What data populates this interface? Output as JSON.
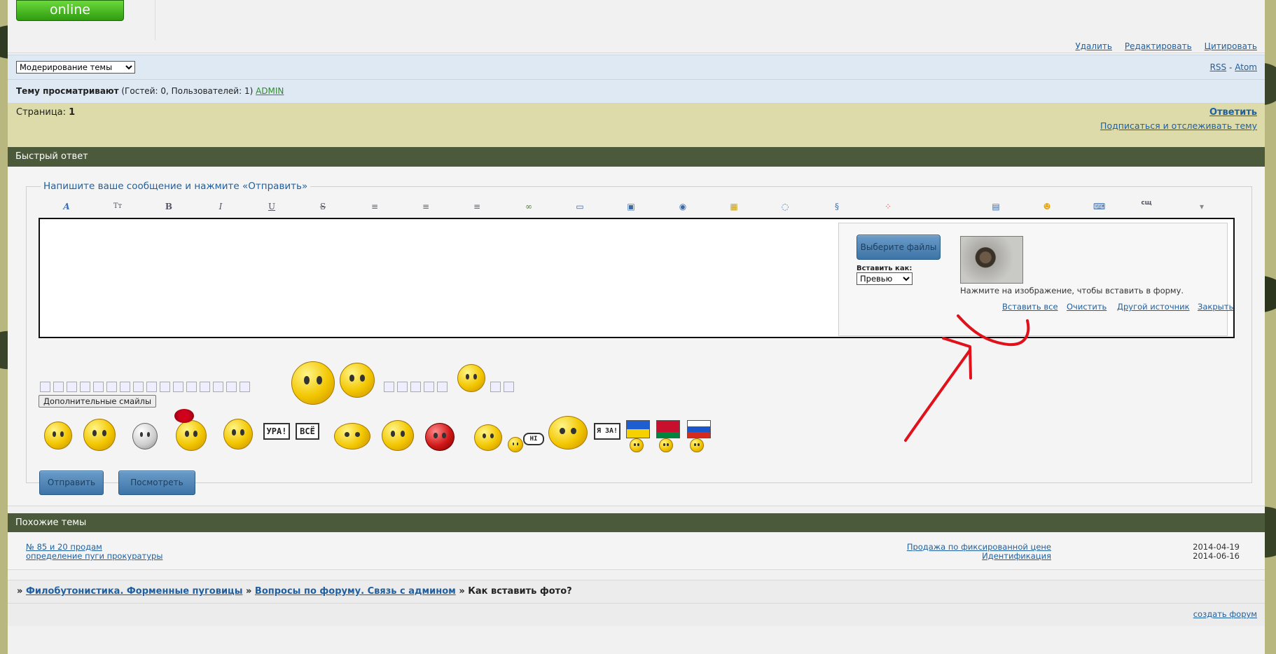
{
  "online_badge": "online",
  "post_actions": {
    "delete": "Удалить",
    "edit": "Редактировать",
    "quote": "Цитировать"
  },
  "moderation": {
    "select_value": "Модерирование темы",
    "rss": "RSS",
    "separator": "-",
    "atom": "Atom"
  },
  "viewers": {
    "label": "Тему просматривают",
    "counts": "(Гостей: 0, Пользователей: 1)",
    "user": "ADMIN"
  },
  "pagination": {
    "label": "Страница:",
    "current": "1",
    "reply": "Ответить",
    "subscribe": "Подписаться и отслеживать тему"
  },
  "quick_reply": {
    "header": "Быстрый ответ",
    "legend": "Напишите ваше сообщение и нажмите «Отправить»",
    "toolbar_icons": [
      "font-icon",
      "text-size-icon",
      "bold-icon",
      "italic-icon",
      "underline-icon",
      "strike-icon",
      "align-left-icon",
      "align-center-icon",
      "align-right-icon",
      "link-icon",
      "book-icon",
      "image-icon",
      "video-icon",
      "lock-icon",
      "speech-bubble-icon",
      "script-icon",
      "color-palette-icon",
      "table-icon",
      "smiley-icon",
      "keyboard-icon",
      "translit-icon",
      "more-arrow-icon"
    ],
    "toolbar_glyph_last": "сщ",
    "upload": {
      "choose_files": "Выберите файлы",
      "insert_as_label": "Вставить как:",
      "insert_as_value": "Превью",
      "hint": "Нажмите на изображение, чтобы вставить в форму.",
      "insert_all": "Вставить все",
      "clear": "Очистить",
      "other_source": "Другой источник",
      "close": "Закрыть"
    },
    "more_smilies": "Дополнительные смайлы",
    "signs": {
      "ura": "УРА!",
      "vse": "ВСЁ",
      "ya_za": "Я ЗА!",
      "hi": "HI"
    },
    "submit": "Отправить",
    "preview": "Посмотреть"
  },
  "similar": {
    "header": "Похожие темы",
    "rows": [
      {
        "title": "№ 85 и 20 продам",
        "forum": "Продажа по фиксированной цене",
        "date": "2014-04-19"
      },
      {
        "title": "определение пуги прокуратуры",
        "forum": "Идентификация",
        "date": "2014-06-16"
      }
    ]
  },
  "breadcrumb": {
    "sep": "»",
    "items": [
      "Филобутонистика. Форменные пуговицы",
      "Вопросы по форуму. Связь с админом"
    ],
    "current": "Как вставить фото?"
  },
  "footer": {
    "create_forum": "создать форум"
  },
  "colors": {
    "annotation": "#e0111b",
    "header_bg": "#4b5a3a",
    "olive_bg": "#dcdba9",
    "link": "#1f5f9f"
  }
}
